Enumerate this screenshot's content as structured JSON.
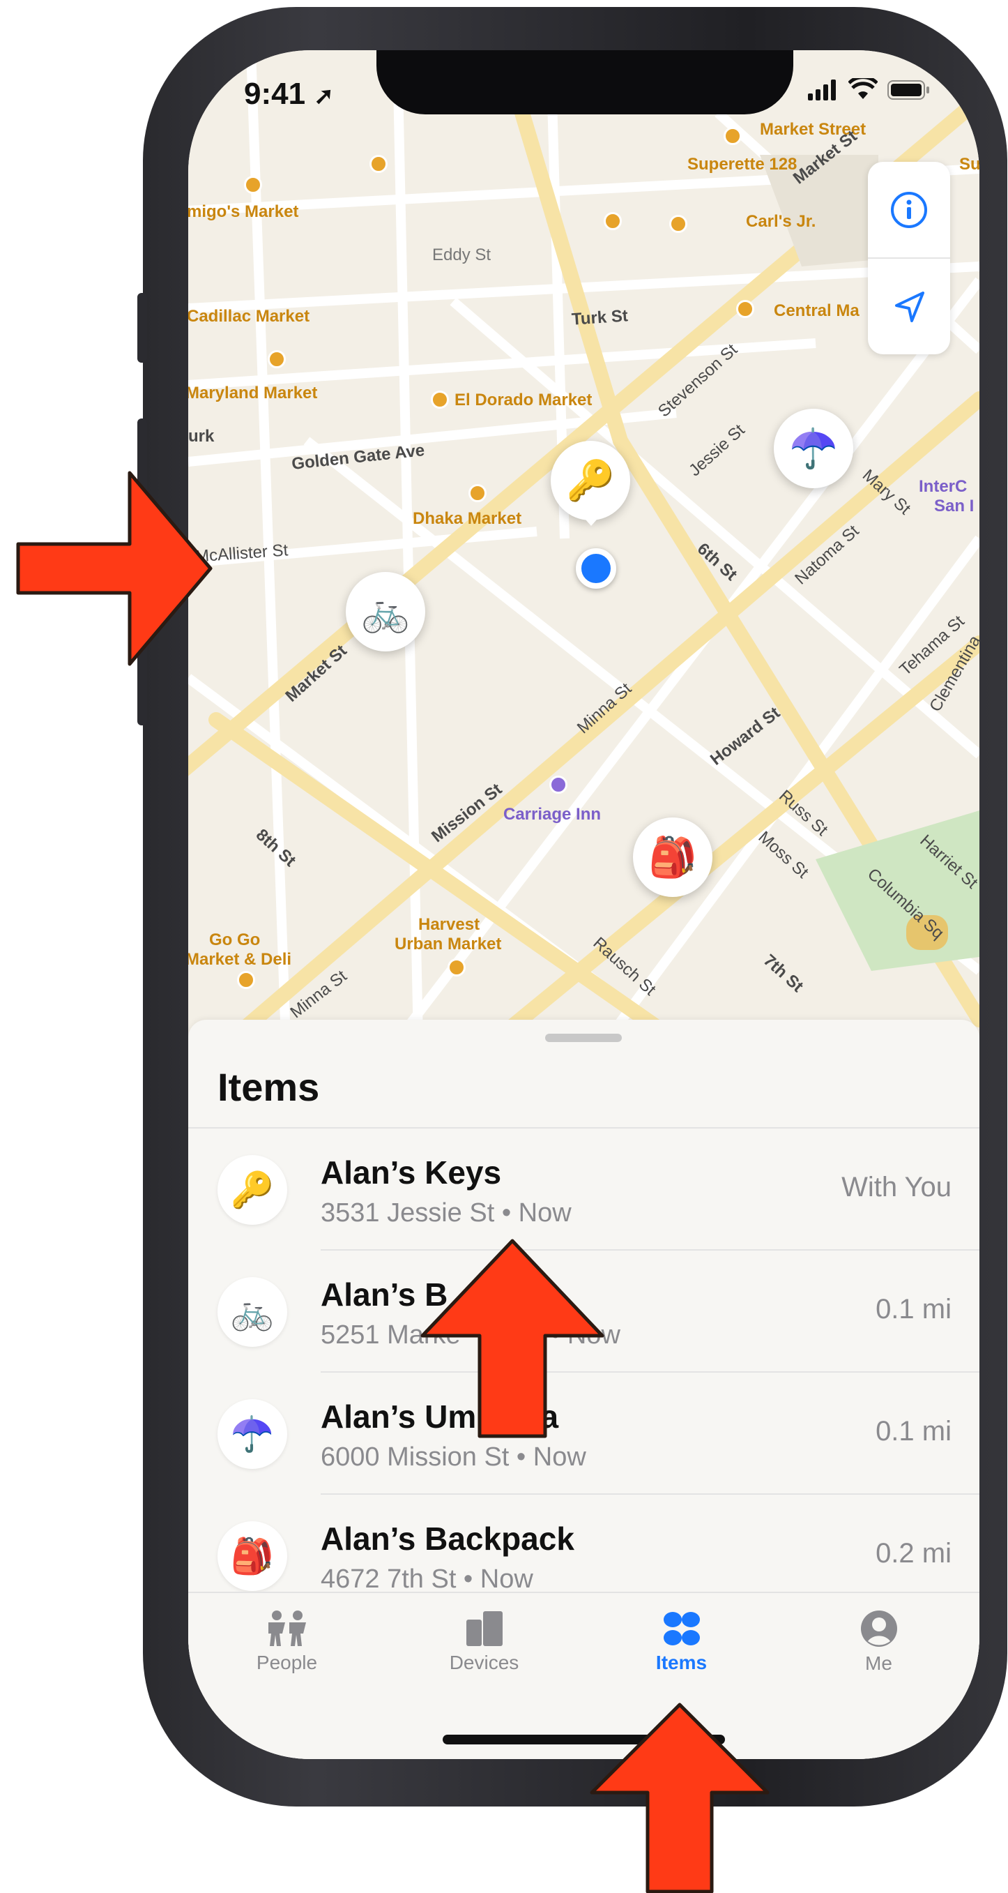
{
  "status_bar": {
    "time": "9:41"
  },
  "map": {
    "poi_labels": [
      "Market Street",
      "Superette 128",
      "Carl's Jr.",
      "migo's Market",
      "Cadillac Market",
      "Central Ma",
      "Maryland Market",
      "El Dorado Market",
      "Dhaka Market",
      "Carriage Inn",
      "Harvest",
      "Urban Market",
      "Go Go",
      "Market & Deli",
      "InterC",
      "San I"
    ],
    "street_labels": [
      "Market St",
      "Eddy St",
      "Turk St",
      "Stevenson St",
      "Jessie St",
      "Golden Gate Ave",
      "McAllister St",
      "6th St",
      "Natoma St",
      "Mary St",
      "Market St",
      "Tehama St",
      "Clementina",
      "Minna St",
      "Howard St",
      "Mission St",
      "8th St",
      "Russ St",
      "Moss St",
      "Harriet St",
      "Columbia Sq",
      "7th St",
      "Rausch St",
      "Minna St",
      "urk",
      "Su"
    ],
    "controls": {
      "info": "info-icon",
      "locate": "location-arrow-icon"
    }
  },
  "sheet": {
    "title": "Items",
    "items": [
      {
        "name": "Alan’s Keys",
        "detail": "3531 Jessie St • Now",
        "status": "With You",
        "icon": "key-icon"
      },
      {
        "name": "Alan’s B",
        "detail": "5251 Marke",
        "detail_tail": "• Now",
        "status": "0.1 mi",
        "icon": "bicycle-icon"
      },
      {
        "name": "Alan’s Um",
        "name_tail": "lla",
        "detail": "6000 Mission St • Now",
        "status": "0.1 mi",
        "icon": "umbrella-icon"
      },
      {
        "name": "Alan’s Backpack",
        "detail": "4672 7th St • Now",
        "status": "0.2 mi",
        "icon": "backpack-icon"
      }
    ]
  },
  "tabs": [
    {
      "label": "People",
      "icon": "people-icon",
      "active": false
    },
    {
      "label": "Devices",
      "icon": "devices-icon",
      "active": false
    },
    {
      "label": "Items",
      "icon": "items-icon",
      "active": true
    },
    {
      "label": "Me",
      "icon": "person-circle-icon",
      "active": false
    }
  ],
  "colors": {
    "accent": "#1a78ff",
    "arrow": "#ff3a16",
    "poi": "#c9860f"
  }
}
